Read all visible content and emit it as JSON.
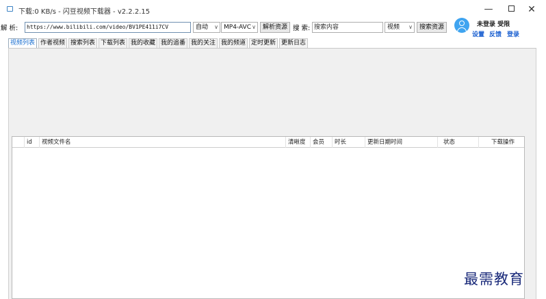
{
  "window": {
    "title": "下载:0 KB/s - 闪豆视频下载器 - v2.2.2.15",
    "minimize": "—",
    "close": "✕",
    "icon": "app-icon"
  },
  "toolbar": {
    "parse_label": "解 析:",
    "url_value": "https://www.bilibili.com/video/BV1PE411i7CV",
    "mode_select": "自动",
    "format_select": "MP4-AVC",
    "parse_button": "解析资源",
    "search_label": "搜 索:",
    "search_placeholder": "搜索内容",
    "search_type_select": "视频",
    "search_button": "搜索资源"
  },
  "user": {
    "status": "未登录 受限",
    "links": [
      "设置",
      "反馈",
      "登录"
    ]
  },
  "tabs": [
    "视频列表",
    "作者视频",
    "搜索列表",
    "下载列表",
    "我的收藏",
    "我的追番",
    "我的关注",
    "我的频道",
    "定时更新",
    "更新日志"
  ],
  "table": {
    "columns": [
      "id",
      "视频文件名",
      "清晰度",
      "会员",
      "时长",
      "更新日期时间",
      "状态",
      "下载操作"
    ],
    "rows": []
  },
  "watermark": "最需教育"
}
